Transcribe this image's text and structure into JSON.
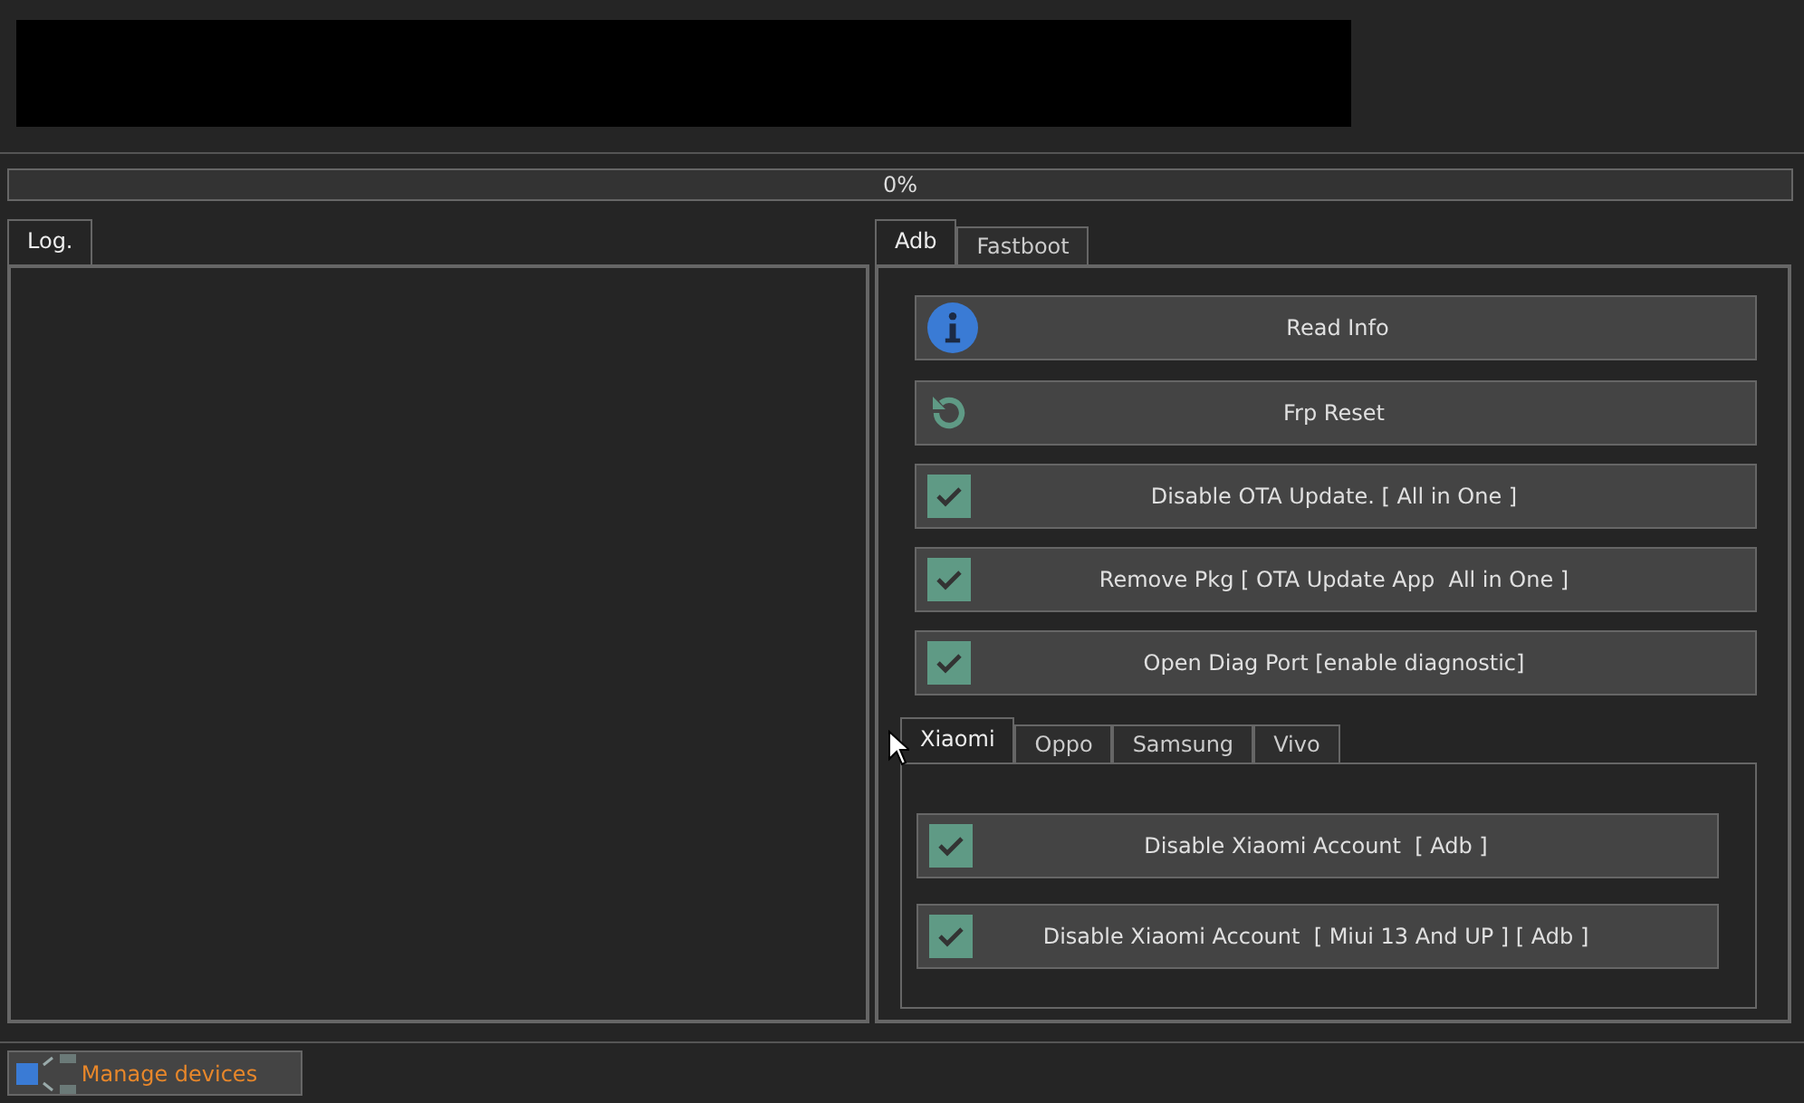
{
  "progress": {
    "label": "0%",
    "level": 0
  },
  "log_tabs": [
    {
      "label": "Log.",
      "selected": true
    }
  ],
  "mode_tabs": [
    {
      "label": "Adb",
      "selected": true
    },
    {
      "label": "Fastboot",
      "selected": false
    }
  ],
  "actions": [
    {
      "kind": "info",
      "label": "Read Info"
    },
    {
      "kind": "reset",
      "label": "Frp Reset"
    },
    {
      "kind": "check",
      "label": "Disable OTA Update. [ All in One ]"
    },
    {
      "kind": "check",
      "label": "Remove Pkg [ OTA Update App  All in One ]"
    },
    {
      "kind": "check",
      "label": "Open Diag Port [enable diagnostic]"
    }
  ],
  "brand_tabs": [
    {
      "label": "Xiaomi",
      "selected": true
    },
    {
      "label": "Oppo",
      "selected": false
    },
    {
      "label": "Samsung",
      "selected": false
    },
    {
      "label": "Vivo",
      "selected": false
    }
  ],
  "brand_actions": [
    {
      "kind": "check",
      "label": "Disable Xiaomi Account  [ Adb ]"
    },
    {
      "kind": "check",
      "label": "Disable Xiaomi Account  [ Miui 13 And UP ] [ Adb ]"
    }
  ],
  "manage_button": {
    "label": "Manage devices"
  }
}
